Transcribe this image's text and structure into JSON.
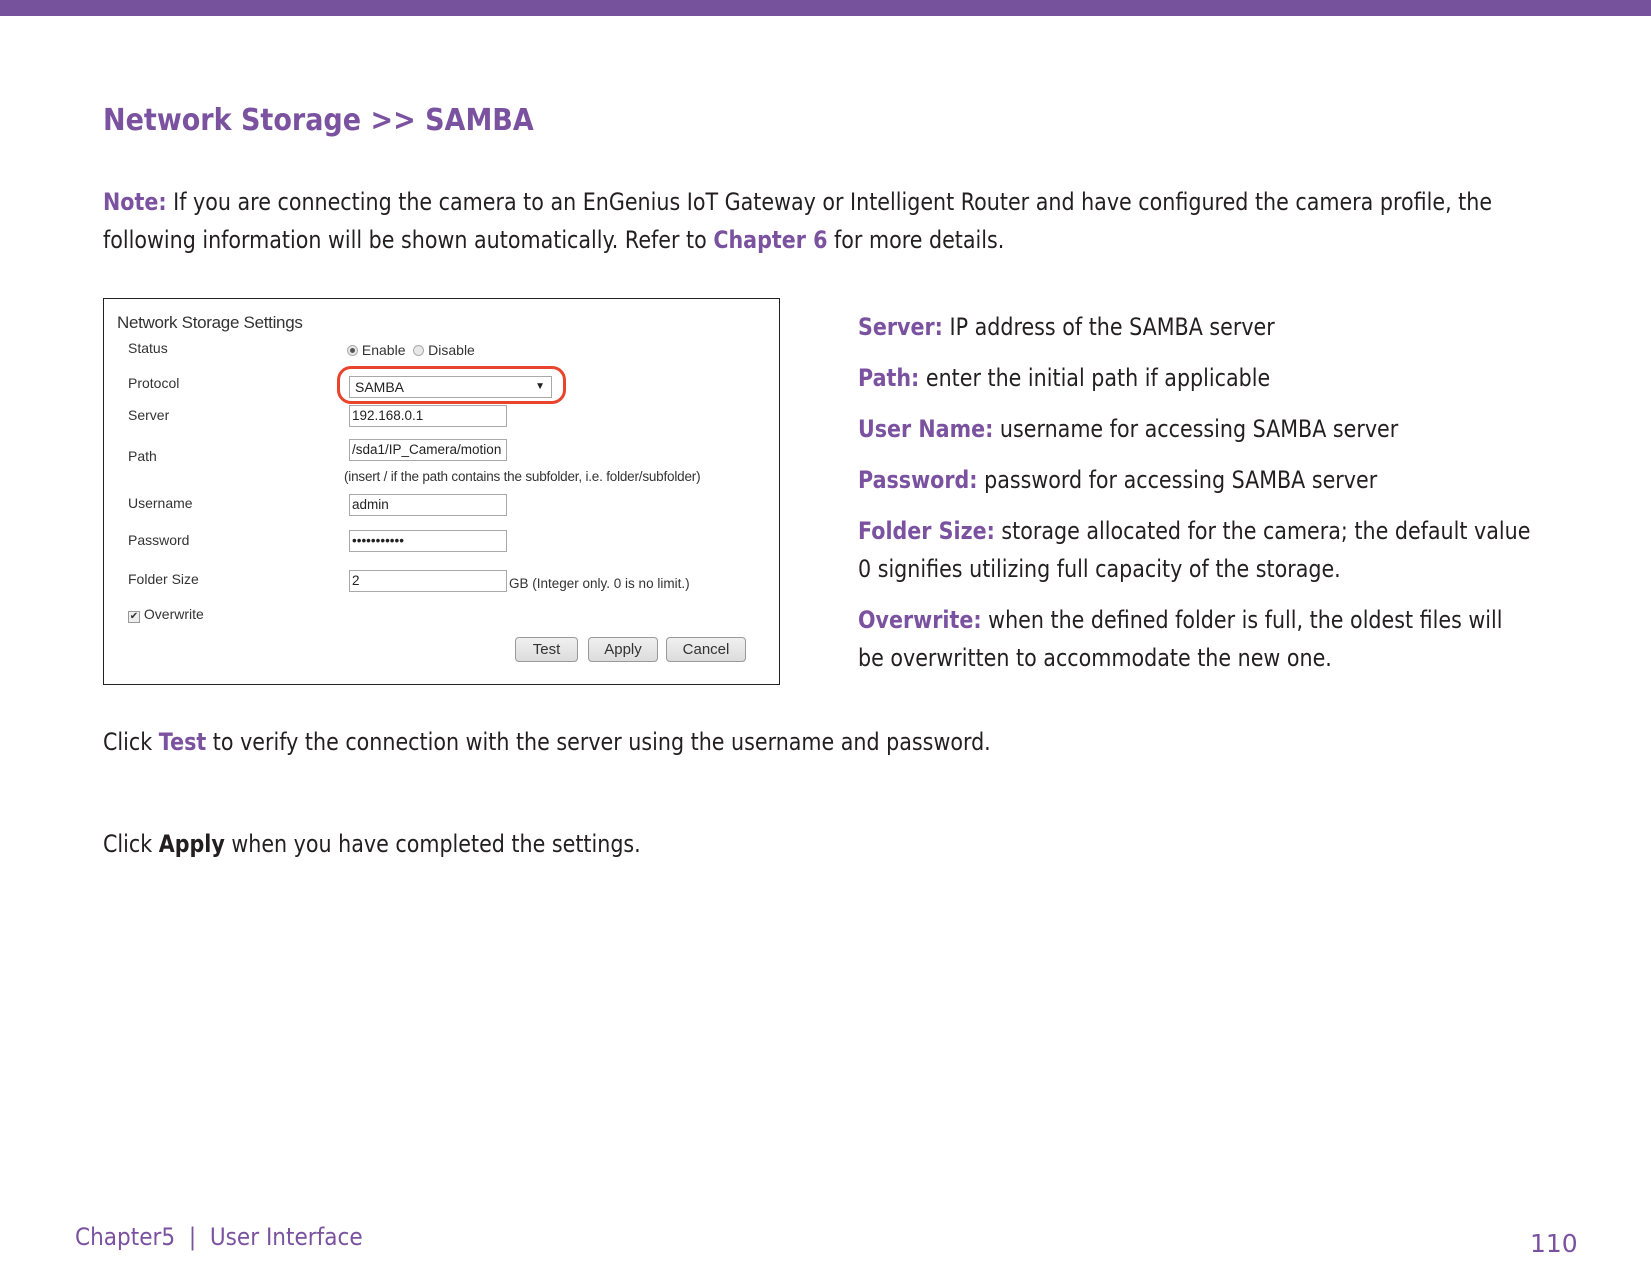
{
  "colors": {
    "accent": "#7a52a0",
    "top_bar": "#77529c",
    "highlight_ring": "#e8452c"
  },
  "heading": "Network Storage >> SAMBA",
  "note": {
    "label": "Note:",
    "text_before": " If you are connecting the camera to an EnGenius IoT Gateway or Intelligent Router and have configured the camera profile, the following information will be shown automatically. Refer to ",
    "link": "Chapter 6",
    "text_after": " for more details."
  },
  "settings_panel": {
    "title": "Network Storage Settings",
    "status": {
      "label": "Status",
      "options": [
        "Enable",
        "Disable"
      ],
      "selected": "Enable"
    },
    "protocol": {
      "label": "Protocol",
      "value": "SAMBA"
    },
    "server": {
      "label": "Server",
      "value": "192.168.0.1"
    },
    "path": {
      "label": "Path",
      "value": "/sda1/IP_Camera/motion",
      "hint": "(insert / if the path contains the subfolder, i.e. folder/subfolder)"
    },
    "username": {
      "label": "Username",
      "value": "admin"
    },
    "password": {
      "label": "Password",
      "value": "•••••••••••"
    },
    "folder_size": {
      "label": "Folder Size",
      "value": "2",
      "unit_hint": "GB (Integer only. 0 is no limit.)"
    },
    "overwrite": {
      "label": "Overwrite",
      "checked": true
    },
    "buttons": {
      "test": "Test",
      "apply": "Apply",
      "cancel": "Cancel"
    }
  },
  "definitions": [
    {
      "label": "Server:",
      "text": " IP address of the SAMBA server"
    },
    {
      "label": "Path:",
      "text": " enter the initial path if applicable"
    },
    {
      "label": "User Name:",
      "text": " username for accessing SAMBA server"
    },
    {
      "label": "Password:",
      "text": " password for accessing SAMBA server"
    },
    {
      "label": "Folder Size:",
      "text": " storage allocated for the camera; the default value",
      "text2": "0 signifies utilizing full capacity of the storage."
    },
    {
      "label": "Overwrite:",
      "text": " when the defined folder is full, the oldest files will",
      "text2": "be overwritten to accommodate the new one."
    }
  ],
  "instructions": {
    "test": {
      "prefix": "Click ",
      "keyword": "Test",
      "suffix": " to verify the connection with the server using the username and password."
    },
    "apply": {
      "prefix": "Click ",
      "keyword": "Apply",
      "suffix": " when you have completed the settings."
    }
  },
  "footer": {
    "chapter": "Chapter5  |  User Interface",
    "page_number": "110"
  }
}
